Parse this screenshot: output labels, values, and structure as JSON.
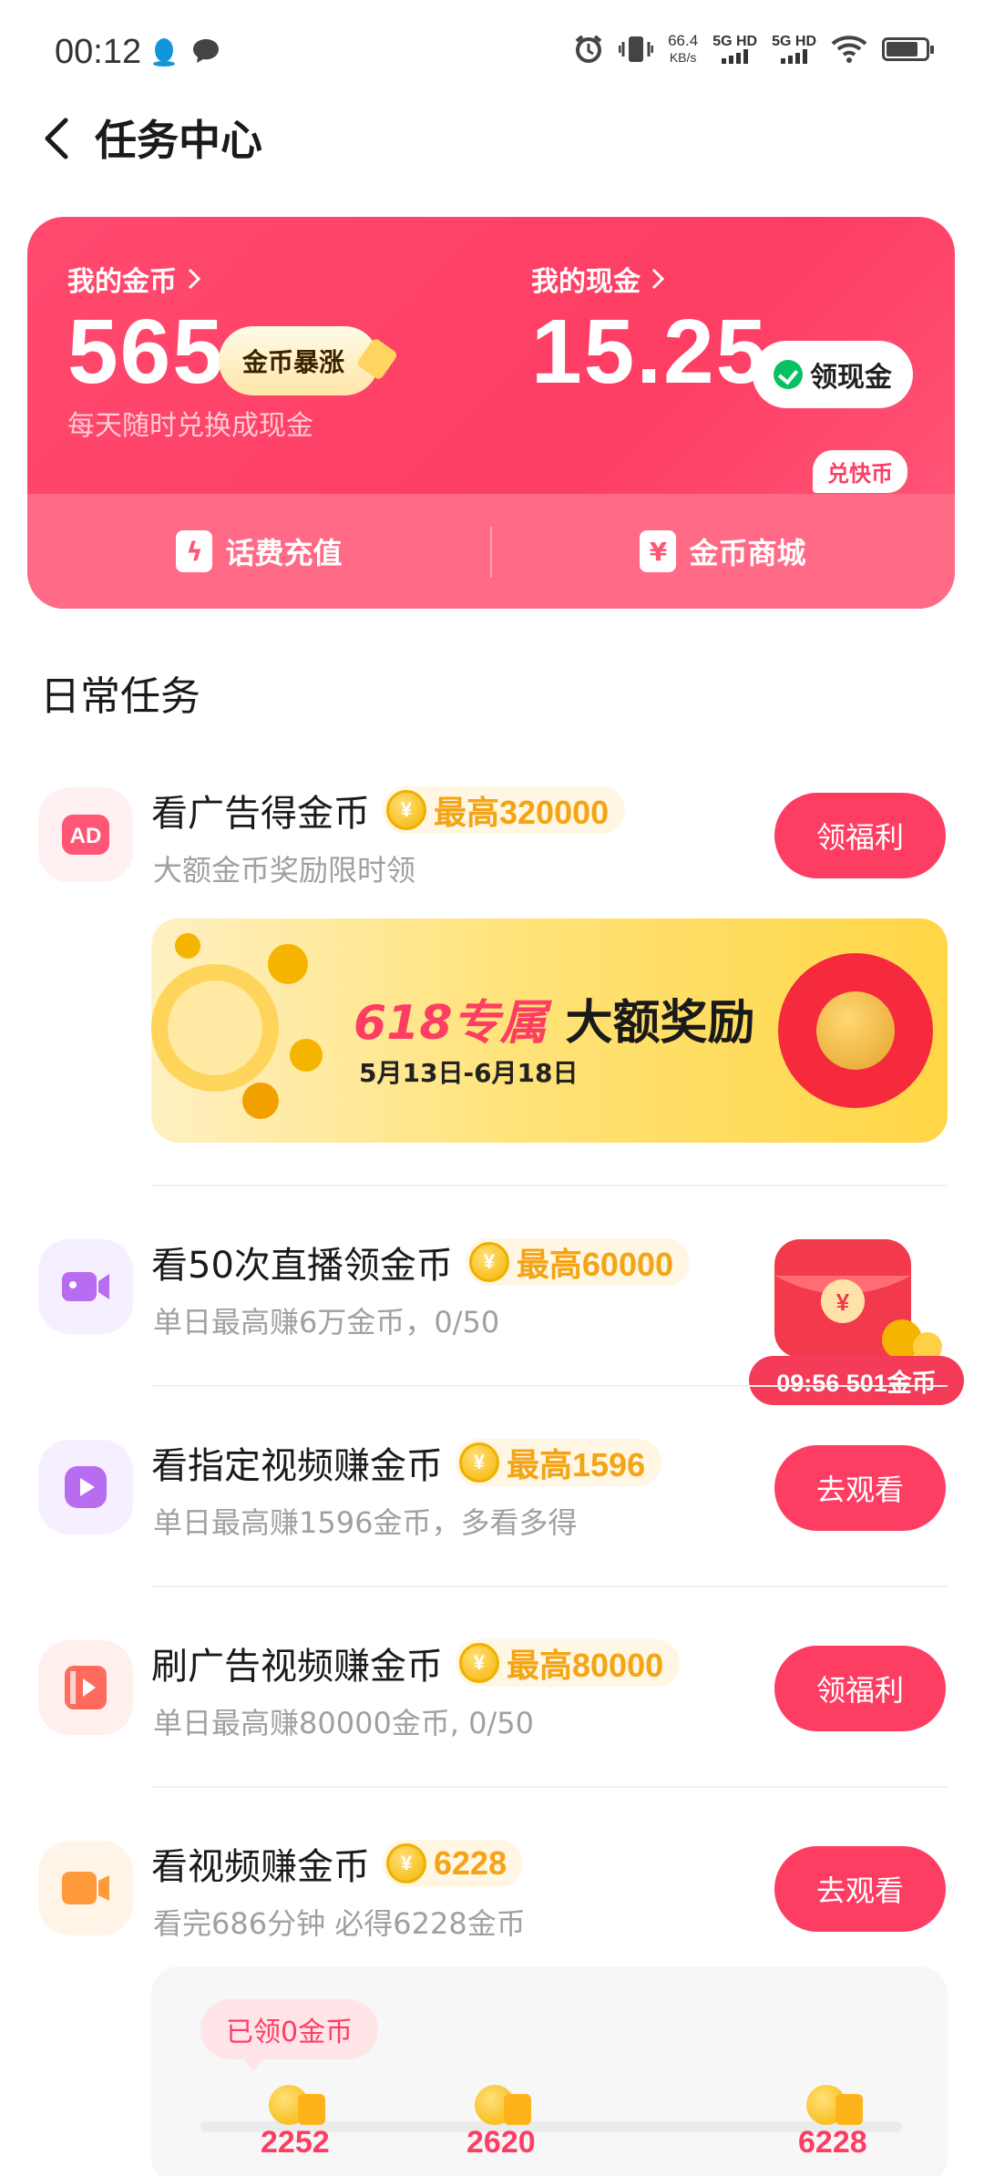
{
  "status_bar": {
    "time": "00:12",
    "speed_value": "66.4",
    "speed_unit": "KB/s",
    "sim1": "5G HD",
    "sim2": "5G HD"
  },
  "header": {
    "title": "任务中心"
  },
  "wallet": {
    "coins_label": "我的金币",
    "coins_value": "565",
    "coins_tag": "金币暴涨",
    "coins_sub": "每天随时兑换成现金",
    "cash_label": "我的现金",
    "cash_value": "15.25",
    "cash_button": "领现金",
    "recharge_label": "话费充值",
    "mall_label": "金币商城",
    "mall_badge": "兑快币"
  },
  "daily": {
    "section_title": "日常任务",
    "tasks": [
      {
        "title": "看广告得金币",
        "badge": "最高320000",
        "subtitle": "大额金币奖励限时领",
        "button": "领福利",
        "icon": "ad-icon",
        "icon_color": "#ff5676"
      },
      {
        "title": "看50次直播领金币",
        "badge": "最高60000",
        "subtitle": "单日最高赚6万金币，0/50",
        "button": "",
        "icon": "camera-icon",
        "icon_color": "#b86cf0"
      },
      {
        "title": "看指定视频赚金币",
        "badge": "最高1596",
        "subtitle": "单日最高赚1596金币，多看多得",
        "button": "去观看",
        "icon": "play-icon",
        "icon_color": "#b86cf0"
      },
      {
        "title": "刷广告视频赚金币",
        "badge": "最高80000",
        "subtitle": "单日最高赚80000金币, 0/50",
        "button": "领福利",
        "icon": "video-ad-icon",
        "icon_color": "#ff6b5c"
      },
      {
        "title": "看视频赚金币",
        "badge": "6228",
        "subtitle": "看完686分钟 必得6228金币",
        "button": "去观看",
        "icon": "video-camera-icon",
        "icon_color": "#ff9a3a"
      }
    ]
  },
  "banner": {
    "highlight": "618专属",
    "title": "大额奖励",
    "date_range": "5月13日-6月18日"
  },
  "floating_packet": {
    "timer": "09:56 501金币"
  },
  "progress": {
    "claimed": "已领0金币",
    "milestones": [
      "2252",
      "2620",
      "6228"
    ]
  },
  "colors": {
    "brand": "#fe3d63",
    "coin_gold": "#f5b400"
  }
}
